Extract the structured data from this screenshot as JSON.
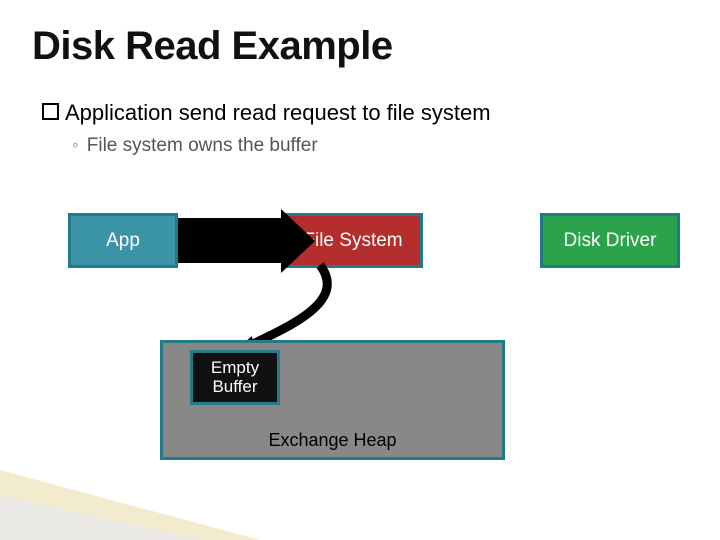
{
  "title": "Disk Read Example",
  "bullet1_strong": "Application",
  "bullet1_rest": " send read request to file system",
  "bullet2": "File system owns the buffer",
  "boxes": {
    "app": "App",
    "fs": "File System",
    "dd": "Disk Driver",
    "buf": "Empty Buffer",
    "heap": "Exchange Heap"
  },
  "colors": {
    "app_bg": "#3b94a6",
    "fs_bg": "#b52e2e",
    "dd_bg": "#2aa34a",
    "border": "#237a8a",
    "heap_bg": "#888888",
    "arrow": "#000000"
  }
}
